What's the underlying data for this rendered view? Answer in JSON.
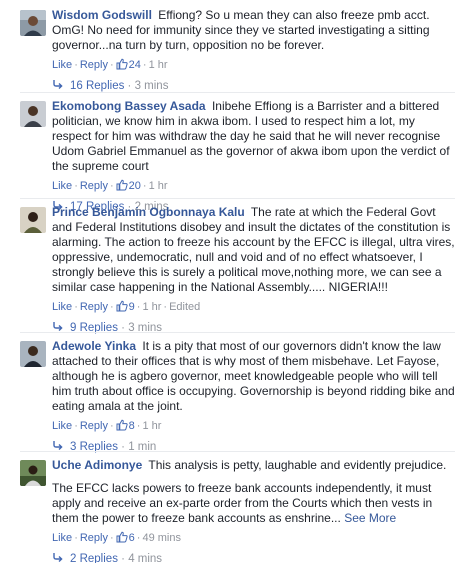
{
  "comments": [
    {
      "name": "Wisdom Godswill",
      "text": "Effiong? So u mean they can also freeze pmb acct. OmG! No need for immunity since they ve started investigating a sitting governor...na turn by turn, opposition no be forever.",
      "like_label": "Like",
      "reply_label": "Reply",
      "likes": "24",
      "time": "1 hr",
      "edited": "",
      "replies_label": "16 Replies",
      "replies_time": "3 mins",
      "see_more": ""
    },
    {
      "name": "Ekomobong Bassey Asada",
      "text": "Inibehe Effiong is a Barrister and a bittered politician, we know him in akwa ibom. I used to respect him a lot, my respect for him was withdraw the day he said that he will never recognise Udom Gabriel Emmanuel as the governor of akwa ibom upon the verdict of the supreme court",
      "like_label": "Like",
      "reply_label": "Reply",
      "likes": "20",
      "time": "1 hr",
      "edited": "",
      "replies_label": "17 Replies",
      "replies_time": "2 mins",
      "see_more": ""
    },
    {
      "name": "Prince Benjamin Ogbonnaya Kalu",
      "text": "The rate at which the Federal Govt and Federal Institutions disobey and insult the dictates of the constitution is alarming. The action to freeze his account by the EFCC is illegal, ultra vires, oppressive, undemocratic, null and void and of no effect whatsoever, I strongly believe this is surely a political move,nothing more, we can see a similar case happening in the National Assembly..... NIGERIA!!!",
      "like_label": "Like",
      "reply_label": "Reply",
      "likes": "9",
      "time": "1 hr",
      "edited": "Edited",
      "replies_label": "9 Replies",
      "replies_time": "3 mins",
      "see_more": ""
    },
    {
      "name": "Adewole Yinka",
      "text": "It is a pity that most of our governors didn't know the law attached to their offices that is why most of them misbehave. Let Fayose, although he is agbero governor, meet knowledgeable people who will tell him truth about office is occupying. Governorship is beyond ridding bike and eating amala at the joint.",
      "like_label": "Like",
      "reply_label": "Reply",
      "likes": "8",
      "time": "1 hr",
      "edited": "",
      "replies_label": "3 Replies",
      "replies_time": "1 min",
      "see_more": ""
    },
    {
      "name": "Uche Adimonye",
      "text": "This analysis is petty, laughable and evidently prejudice.",
      "text2": "The EFCC lacks powers to freeze bank accounts independently, it must apply and receive an ex-parte order from the Courts which then vests in them the power to freeze bank accounts as enshrine...",
      "like_label": "Like",
      "reply_label": "Reply",
      "likes": "6",
      "time": "49 mins",
      "edited": "",
      "replies_label": "2 Replies",
      "replies_time": "4 mins",
      "see_more": "See More"
    }
  ],
  "colors": {
    "link": "#365899",
    "action": "#4267b2",
    "meta": "#90949c",
    "text": "#1d2129"
  }
}
